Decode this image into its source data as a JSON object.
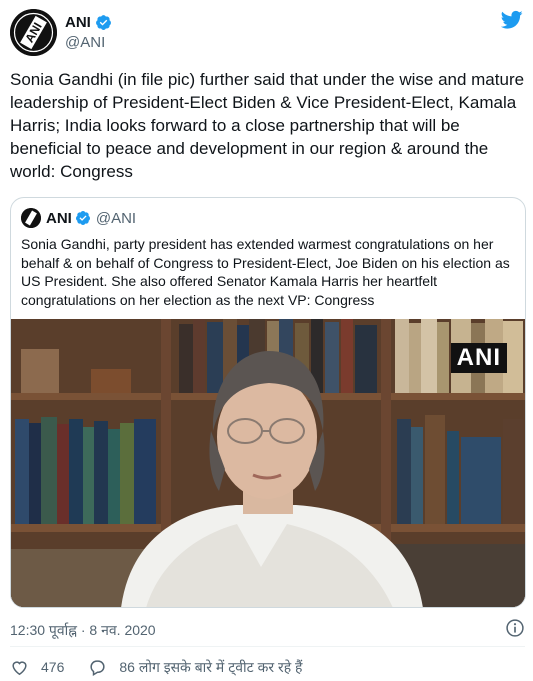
{
  "tweet": {
    "display_name": "ANI",
    "handle": "@ANI",
    "text": "Sonia Gandhi (in file pic) further said that under the wise and mature leadership of President-Elect Biden & Vice President-Elect, Kamala Harris; India looks forward to a close partnership that will be beneficial to peace and development in our region & around the world: Congress",
    "timestamp": "12:30 पूर्वाह्न · 8 नव. 2020",
    "likes": "476",
    "replies_text": "86 लोग इसके बारे में ट्वीट कर रहे हैं"
  },
  "quoted": {
    "display_name": "ANI",
    "handle": "@ANI",
    "text": "Sonia Gandhi, party president has extended warmest congratulations on her behalf & on behalf of Congress to President-Elect, Joe Biden on his election as US President. She also offered Senator Kamala Harris her heartfelt congratulations on her election as the next VP: Congress",
    "media_watermark": "ANI"
  },
  "avatar_logo_text": "ANI",
  "icons": {
    "verified": "verified-badge-icon",
    "brand": "twitter-bird-icon",
    "info": "info-icon",
    "like": "heart-icon",
    "reply": "speech-bubble-icon"
  },
  "colors": {
    "accent": "#1d9bf0",
    "text": "#0f1419",
    "muted": "#536471",
    "border": "#cfd9de"
  }
}
